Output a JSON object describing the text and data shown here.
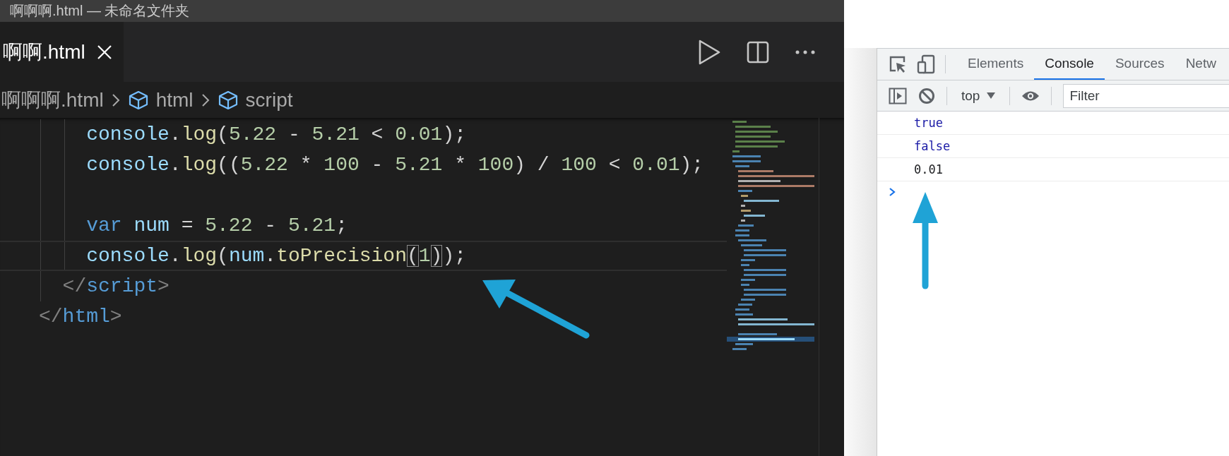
{
  "title_bar": {
    "title": "啊啊啊.html — 未命名文件夹"
  },
  "editor": {
    "tabs": [
      {
        "label": "啊啊.html",
        "selected": true
      }
    ],
    "breadcrumb": [
      {
        "label": "啊啊啊.html",
        "kind": "file"
      },
      {
        "label": "html",
        "kind": "symbol"
      },
      {
        "label": "script",
        "kind": "symbol"
      }
    ],
    "lines": [
      {
        "current": false,
        "tokens": [
          {
            "text": "    console",
            "kind": "variable"
          },
          {
            "text": ".",
            "kind": "punctuation"
          },
          {
            "text": "log",
            "kind": "function"
          },
          {
            "text": "(",
            "kind": "punctuation"
          },
          {
            "text": "5.22",
            "kind": "number"
          },
          {
            "text": " - ",
            "kind": "punctuation"
          },
          {
            "text": "5.21",
            "kind": "number"
          },
          {
            "text": " < ",
            "kind": "punctuation"
          },
          {
            "text": "0.01",
            "kind": "number"
          },
          {
            "text": ");",
            "kind": "punctuation"
          }
        ]
      },
      {
        "current": false,
        "tokens": [
          {
            "text": "    console",
            "kind": "variable"
          },
          {
            "text": ".",
            "kind": "punctuation"
          },
          {
            "text": "log",
            "kind": "function"
          },
          {
            "text": "((",
            "kind": "punctuation"
          },
          {
            "text": "5.22",
            "kind": "number"
          },
          {
            "text": " * ",
            "kind": "punctuation"
          },
          {
            "text": "100",
            "kind": "number"
          },
          {
            "text": " - ",
            "kind": "punctuation"
          },
          {
            "text": "5.21",
            "kind": "number"
          },
          {
            "text": " * ",
            "kind": "punctuation"
          },
          {
            "text": "100",
            "kind": "number"
          },
          {
            "text": ") / ",
            "kind": "punctuation"
          },
          {
            "text": "100",
            "kind": "number"
          },
          {
            "text": " < ",
            "kind": "punctuation"
          },
          {
            "text": "0.01",
            "kind": "number"
          },
          {
            "text": ");",
            "kind": "punctuation"
          }
        ]
      },
      {
        "current": false
      },
      {
        "current": false,
        "tokens": [
          {
            "text": "    var",
            "kind": "keyword"
          },
          {
            "text": " num",
            "kind": "variable"
          },
          {
            "text": " = ",
            "kind": "punctuation"
          },
          {
            "text": "5.22",
            "kind": "number"
          },
          {
            "text": " - ",
            "kind": "punctuation"
          },
          {
            "text": "5.21",
            "kind": "number"
          },
          {
            "text": ";",
            "kind": "punctuation"
          }
        ]
      },
      {
        "current": true,
        "tokens": [
          {
            "text": "    console",
            "kind": "variable"
          },
          {
            "text": ".",
            "kind": "punctuation"
          },
          {
            "text": "log",
            "kind": "function"
          },
          {
            "text": "(",
            "kind": "punctuation"
          },
          {
            "text": "num",
            "kind": "variable"
          },
          {
            "text": ".",
            "kind": "punctuation"
          },
          {
            "text": "toPrecision",
            "kind": "function"
          },
          {
            "text": "(",
            "kind": "bracket"
          },
          {
            "text": "1",
            "kind": "number"
          },
          {
            "text": ")",
            "kind": "bracket"
          },
          {
            "text": ");",
            "kind": "punctuation"
          }
        ]
      },
      {
        "current": false,
        "tokens": [
          {
            "text": "  </",
            "kind": "tag_punctuation"
          },
          {
            "text": "script",
            "kind": "tag"
          },
          {
            "text": ">",
            "kind": "tag_punctuation"
          }
        ]
      },
      {
        "current": false,
        "tokens": [
          {
            "text": "</",
            "kind": "tag_punctuation"
          },
          {
            "text": "html",
            "kind": "tag"
          },
          {
            "text": ">",
            "kind": "tag_punctuation"
          }
        ]
      }
    ]
  },
  "devtools": {
    "tabs": [
      {
        "label": "Elements",
        "selected": false
      },
      {
        "label": "Console",
        "selected": true
      },
      {
        "label": "Sources",
        "selected": false
      },
      {
        "label": "Netw",
        "selected": false
      }
    ],
    "context": "top",
    "filter": {
      "placeholder": "Filter"
    },
    "messages": [
      {
        "text": "true",
        "kind": "boolean"
      },
      {
        "text": "false",
        "kind": "boolean"
      },
      {
        "text": "0.01",
        "kind": "string"
      }
    ]
  }
}
